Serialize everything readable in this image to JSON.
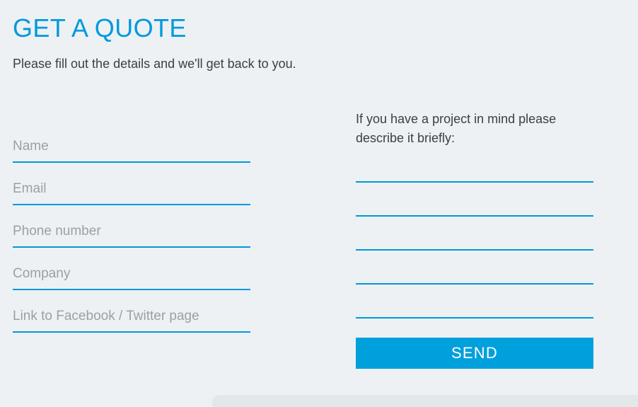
{
  "header": {
    "title": "GET A QUOTE",
    "subtitle": "Please fill out the details and we'll get back to you.",
    "title_color": "#0099dd",
    "subtitle_color": "#3b4043"
  },
  "theme": {
    "background": "#edf1f4",
    "accent": "#0099d8",
    "button_background": "#00a0dd",
    "button_text": "#ffffff",
    "underline": "#0099d8",
    "placeholder": "#9aa0a4",
    "bottom_panel": "#e2e7ea"
  },
  "form": {
    "left_fields": [
      {
        "name": "name",
        "placeholder": "Name",
        "value": ""
      },
      {
        "name": "email",
        "placeholder": "Email",
        "value": ""
      },
      {
        "name": "phone",
        "placeholder": "Phone number",
        "value": ""
      },
      {
        "name": "company",
        "placeholder": "Company",
        "value": ""
      },
      {
        "name": "social",
        "placeholder": "Link to Facebook / Twitter page",
        "value": ""
      }
    ],
    "right": {
      "label": "If you have a project in mind please describe it briefly:",
      "lines": [
        {
          "name": "description-line-1",
          "value": "",
          "placeholder": ""
        },
        {
          "name": "description-line-2",
          "value": "",
          "placeholder": ""
        },
        {
          "name": "description-line-3",
          "value": "",
          "placeholder": ""
        },
        {
          "name": "description-line-4",
          "value": "",
          "placeholder": ""
        },
        {
          "name": "description-line-5",
          "value": "",
          "placeholder": ""
        }
      ]
    },
    "submit_label": "SEND"
  }
}
